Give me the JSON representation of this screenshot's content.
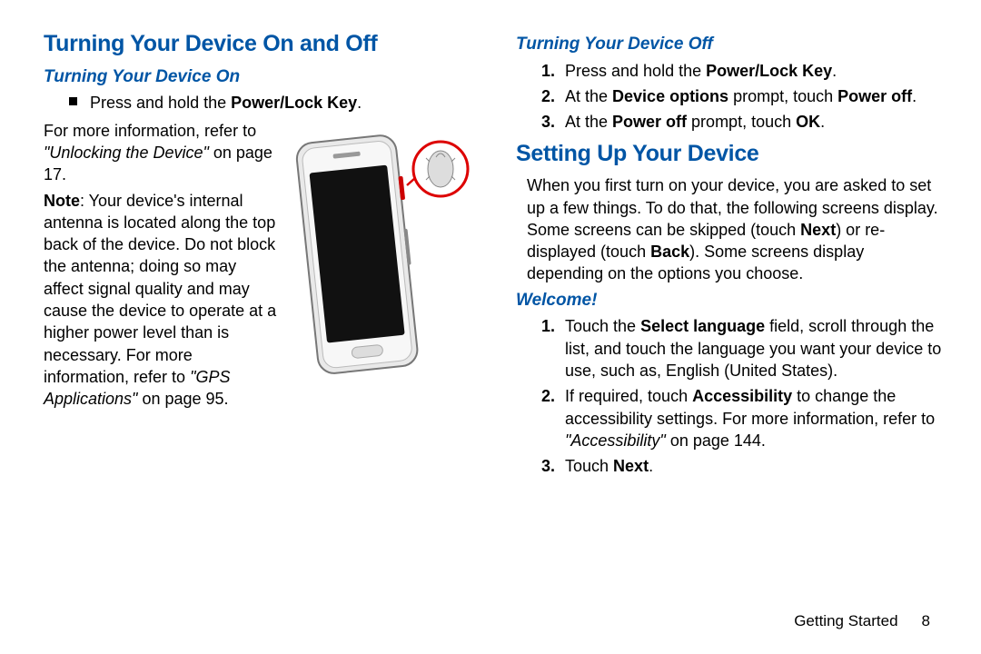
{
  "left": {
    "h1": "Turning Your Device On and Off",
    "sub1": "Turning Your Device On",
    "bullet1_pre": "Press and hold the ",
    "bullet1_bold": "Power/Lock Key",
    "bullet1_post": ".",
    "para1_a": "For more information, refer to ",
    "para1_ref": "\"Unlocking the Device\"",
    "para1_b": " on page 17.",
    "note_label": "Note",
    "note_a": ": Your device's internal antenna is located along the top back of the device. Do not block the antenna; doing so may affect signal quality and may cause the device to operate at a higher power level than is necessary. For more information, refer to ",
    "note_ref": "\"GPS Applications\"",
    "note_b": " on page 95."
  },
  "right": {
    "sub_off": "Turning Your Device Off",
    "off_steps": [
      {
        "pre": "Press and hold the ",
        "b1": "Power/Lock Key",
        "post": "."
      },
      {
        "pre": "At the ",
        "b1": "Device options",
        "mid": " prompt, touch ",
        "b2": "Power off",
        "post": "."
      },
      {
        "pre": "At the ",
        "b1": "Power off",
        "mid": " prompt, touch ",
        "b2": "OK",
        "post": "."
      }
    ],
    "h1_setup": "Setting Up Your Device",
    "setup_para_a": "When you first turn on your device, you are asked to set up a few things. To do that, the following screens display. Some screens can be skipped (touch ",
    "setup_b1": "Next",
    "setup_para_b": ") or re-displayed (touch ",
    "setup_b2": "Back",
    "setup_para_c": "). Some screens display depending on the options you choose.",
    "sub_welcome": "Welcome!",
    "welcome_steps": [
      {
        "pre": "Touch the ",
        "b1": "Select language",
        "post": " field, scroll through the list, and touch the language you want your device to use, such as, English (United States)."
      },
      {
        "pre": "If required, touch ",
        "b1": "Accessibility",
        "mid": " to change the accessibility settings. For more information, refer to ",
        "ref": "\"Accessibility\"",
        "post": " on page 144."
      },
      {
        "pre": "Touch ",
        "b1": "Next",
        "post": "."
      }
    ]
  },
  "footer": {
    "section": "Getting Started",
    "page": "8"
  }
}
